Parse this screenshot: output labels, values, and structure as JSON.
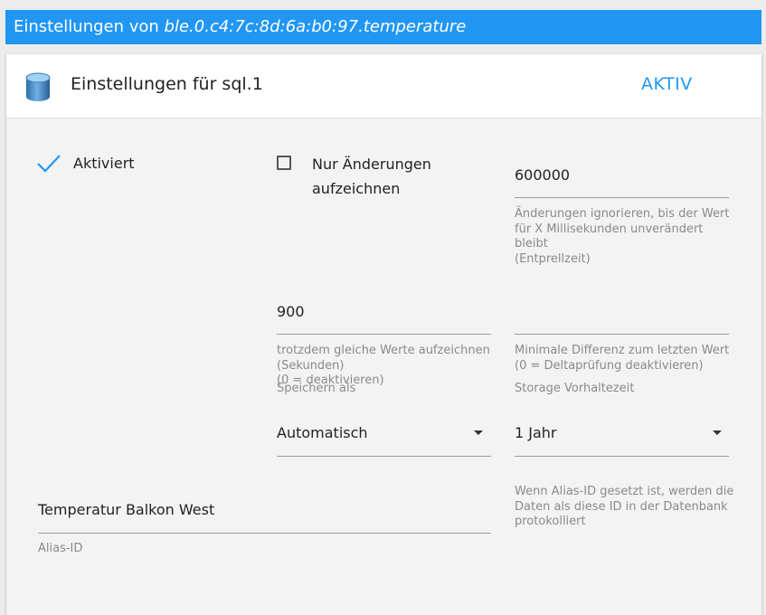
{
  "titlebar": {
    "prefix": "Einstellungen von ",
    "object_id": "ble.0.c4:7c:8d:6a:b0:97.temperature"
  },
  "panel": {
    "title": "Einstellungen für sql.1",
    "status": "AKTIV"
  },
  "form": {
    "enabled_label": "Aktiviert",
    "enabled": true,
    "changes_only_label": "Nur Änderungen aufzeichnen",
    "changes_only": false,
    "debounce": {
      "value": "600000",
      "help_line1": "Änderungen ignorieren, bis der Wert",
      "help_line2": "für X Millisekunden unverändert",
      "help_line3": "bleibt",
      "help_line4": "(Entprellzeit)"
    },
    "retention_same": {
      "value": "900",
      "help_line1": "trotzdem gleiche Werte aufzeichnen",
      "help_line2": "(Sekunden)",
      "help_line3": "(0 = deaktivieren)"
    },
    "min_delta": {
      "value": "",
      "help_line1": "Minimale Differenz zum letzten Wert",
      "help_line2": "(0 = Deltaprüfung deaktivieren)"
    },
    "store_as": {
      "label": "Speichern als",
      "selected": "Automatisch"
    },
    "storage_retention": {
      "label": "Storage Vorhaltezeit",
      "selected": "1 Jahr"
    },
    "alias": {
      "value": "Temperatur Balkon West",
      "label": "Alias-ID",
      "help_line1": "Wenn Alias-ID gesetzt ist, werden die",
      "help_line2": "Daten als diese ID in der Datenbank",
      "help_line3": "protokolliert"
    }
  },
  "colors": {
    "accent": "#2196f3",
    "helper_text": "#8a8a8a",
    "underline": "#9e9e9e"
  },
  "icons": {
    "header": "database-icon",
    "enabled": "check-icon",
    "dropdown": "caret-down-icon"
  }
}
